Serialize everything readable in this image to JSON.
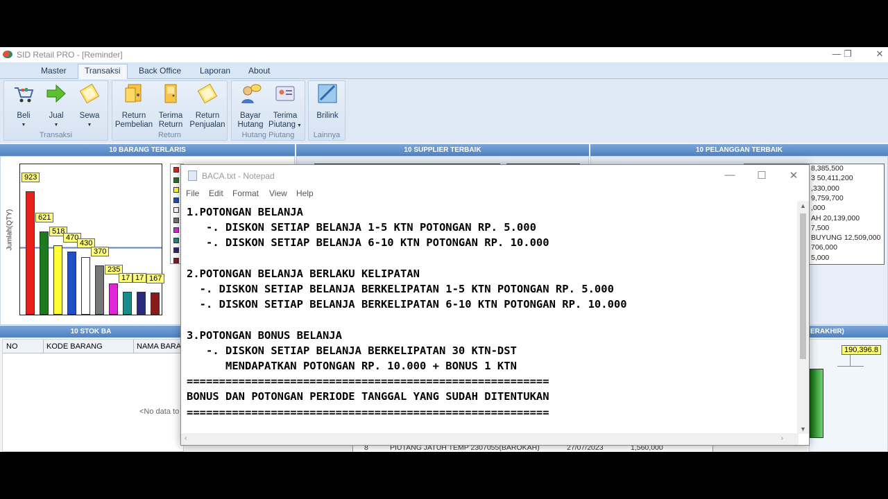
{
  "window": {
    "title": "SID Retail PRO - [Reminder]"
  },
  "tabs": [
    "Master",
    "Transaksi",
    "Back Office",
    "Laporan",
    "About"
  ],
  "ribbon": {
    "groups": [
      {
        "label": "Transaksi",
        "buttons": [
          "Beli",
          "Jual",
          "Sewa"
        ]
      },
      {
        "label": "Return",
        "buttons": [
          "Return Pembelian",
          "Terima Return",
          "Return Penjualan"
        ]
      },
      {
        "label": "Hutang Piutang",
        "buttons": [
          "Bayar Hutang",
          "Terima Piutang"
        ]
      },
      {
        "label": "Lainnya",
        "buttons": [
          "Brilink"
        ]
      }
    ]
  },
  "panels": {
    "top_items": "10 BARANG TERLARIS",
    "top_suppliers": "10 SUPPLIER TERBAIK",
    "top_customers": "10 PELANGGAN TERBAIK",
    "stock": "10 STOK BA",
    "last_sales": "ERAKHIR)"
  },
  "chart_data": {
    "type": "bar",
    "ylabel": "Jumlah(QTY)",
    "values": [
      923,
      621,
      518,
      470,
      430,
      370,
      235,
      170,
      170,
      167
    ],
    "labels": [
      "923",
      "621",
      "518",
      "470",
      "430",
      "370",
      "235",
      "17",
      "17",
      "167"
    ],
    "colors": [
      "#e8211c",
      "#1f7a1f",
      "#ffff33",
      "#1e50c8",
      "#ffffff",
      "#777777",
      "#e026d8",
      "#1a8a8a",
      "#2a2a7a",
      "#8b1a1a"
    ]
  },
  "customers": [
    "8,385,500",
    "3 50,411,200",
    ",330,000",
    "9,759,700",
    ",000",
    "AH 20,139,000",
    "7,500",
    "BUYUNG 12,509,000",
    "706,000",
    "5,000"
  ],
  "stock_table": {
    "columns": [
      "NO",
      "KODE BARANG",
      "NAMA BARA"
    ],
    "empty": "<No data to"
  },
  "last_sales_value": "190,396.8",
  "piutang_row": {
    "no": "8",
    "desc": "PIUTANG JATUH TEMP 2307055(BAROKAH)",
    "date": "27/07/2023",
    "amount": "1,560,000"
  },
  "notepad": {
    "title": "BACA.txt - Notepad",
    "menu": [
      "File",
      "Edit",
      "Format",
      "View",
      "Help"
    ],
    "lines": [
      "1.POTONGAN BELANJA",
      "   -. DISKON SETIAP BELANJA 1-5 KTN POTONGAN RP. 5.000",
      "   -. DISKON SETIAP BELANJA 6-10 KTN POTONGAN RP. 10.000",
      "",
      "2.POTONGAN BELANJA BERLAKU KELIPATAN",
      "  -. DISKON SETIAP BELANJA BERKELIPATAN 1-5 KTN POTONGAN RP. 5.000",
      "  -. DISKON SETIAP BELANJA BERKELIPATAN 6-10 KTN POTONGAN RP. 10.000",
      "",
      "3.POTONGAN BONUS BELANJA",
      "   -. DISKON SETIAP BELANJA BERKELIPATAN 30 KTN-DST",
      "      MENDAPATKAN POTONGAN RP. 10.000 + BONUS 1 KTN",
      "========================================================",
      "BONUS DAN POTONGAN PERIODE TANGGAL YANG SUDAH DITENTUKAN",
      "========================================================"
    ]
  }
}
